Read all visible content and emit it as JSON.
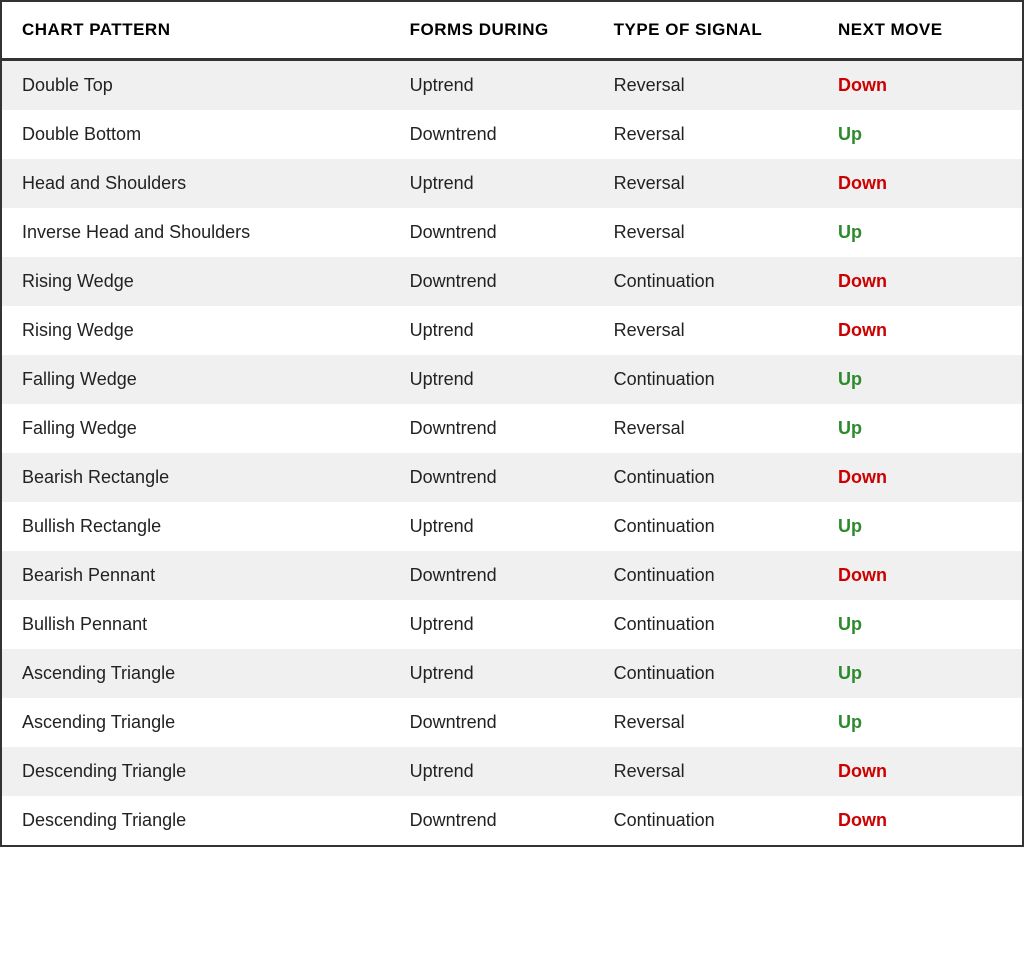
{
  "table": {
    "headers": {
      "col1": "CHART PATTERN",
      "col2": "FORMS DURING",
      "col3": "TYPE OF SIGNAL",
      "col4": "NEXT MOVE"
    },
    "rows": [
      {
        "pattern": "Double Top",
        "forms_during": "Uptrend",
        "signal_type": "Reversal",
        "next_move": "Down",
        "move_direction": "down"
      },
      {
        "pattern": "Double Bottom",
        "forms_during": "Downtrend",
        "signal_type": "Reversal",
        "next_move": "Up",
        "move_direction": "up"
      },
      {
        "pattern": "Head and Shoulders",
        "forms_during": "Uptrend",
        "signal_type": "Reversal",
        "next_move": "Down",
        "move_direction": "down"
      },
      {
        "pattern": "Inverse Head and Shoulders",
        "forms_during": "Downtrend",
        "signal_type": "Reversal",
        "next_move": "Up",
        "move_direction": "up"
      },
      {
        "pattern": "Rising Wedge",
        "forms_during": "Downtrend",
        "signal_type": "Continuation",
        "next_move": "Down",
        "move_direction": "down"
      },
      {
        "pattern": "Rising Wedge",
        "forms_during": "Uptrend",
        "signal_type": "Reversal",
        "next_move": "Down",
        "move_direction": "down"
      },
      {
        "pattern": "Falling Wedge",
        "forms_during": "Uptrend",
        "signal_type": "Continuation",
        "next_move": "Up",
        "move_direction": "up"
      },
      {
        "pattern": "Falling Wedge",
        "forms_during": "Downtrend",
        "signal_type": "Reversal",
        "next_move": "Up",
        "move_direction": "up"
      },
      {
        "pattern": "Bearish Rectangle",
        "forms_during": "Downtrend",
        "signal_type": "Continuation",
        "next_move": "Down",
        "move_direction": "down"
      },
      {
        "pattern": "Bullish Rectangle",
        "forms_during": "Uptrend",
        "signal_type": "Continuation",
        "next_move": "Up",
        "move_direction": "up"
      },
      {
        "pattern": "Bearish Pennant",
        "forms_during": "Downtrend",
        "signal_type": "Continuation",
        "next_move": "Down",
        "move_direction": "down"
      },
      {
        "pattern": "Bullish Pennant",
        "forms_during": "Uptrend",
        "signal_type": "Continuation",
        "next_move": "Up",
        "move_direction": "up"
      },
      {
        "pattern": "Ascending Triangle",
        "forms_during": "Uptrend",
        "signal_type": "Continuation",
        "next_move": "Up",
        "move_direction": "up"
      },
      {
        "pattern": "Ascending Triangle",
        "forms_during": "Downtrend",
        "signal_type": "Reversal",
        "next_move": "Up",
        "move_direction": "up"
      },
      {
        "pattern": "Descending Triangle",
        "forms_during": "Uptrend",
        "signal_type": "Reversal",
        "next_move": "Down",
        "move_direction": "down"
      },
      {
        "pattern": "Descending Triangle",
        "forms_during": "Downtrend",
        "signal_type": "Continuation",
        "next_move": "Down",
        "move_direction": "down"
      }
    ]
  }
}
